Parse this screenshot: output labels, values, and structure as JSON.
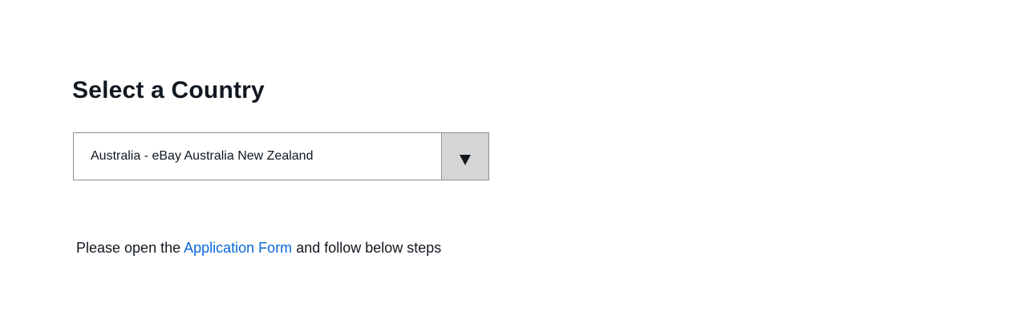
{
  "page": {
    "title": "Select a Country"
  },
  "country_select": {
    "selected_value": "Australia - eBay Australia New Zealand",
    "button_icon": "chevron-down-icon"
  },
  "instruction": {
    "prefix": "Please open the ",
    "link_label": "Application Form",
    "suffix": " and follow below steps"
  },
  "colors": {
    "text": "#111820",
    "link": "#0968dc",
    "dropdown_button_bg": "#d6d6d6",
    "border": "#8f8f8f"
  }
}
